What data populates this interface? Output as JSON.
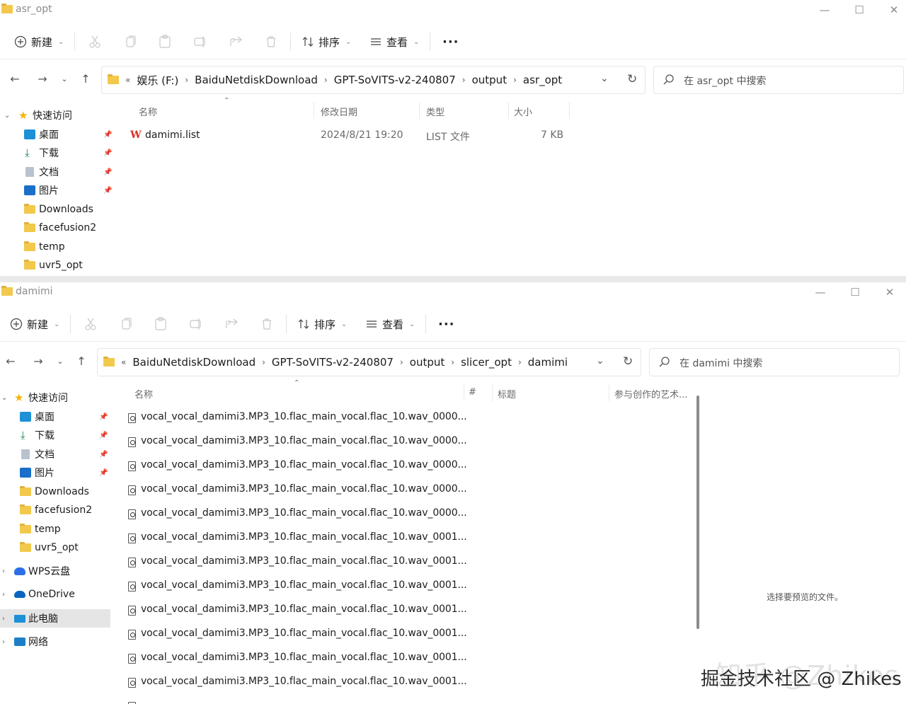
{
  "window1": {
    "title": "asr_opt",
    "toolbar": {
      "new": "新建",
      "sort": "排序",
      "view": "查看",
      "more": "···"
    },
    "breadcrumb": {
      "overflow": "«",
      "items": [
        "娱乐 (F:)",
        "BaiduNetdiskDownload",
        "GPT-SoVITS-v2-240807",
        "output",
        "asr_opt"
      ]
    },
    "search_placeholder": "在 asr_opt 中搜索",
    "sidebar": {
      "quick_access": "快速访问",
      "items": [
        "桌面",
        "下载",
        "文档",
        "图片",
        "Downloads",
        "facefusion2",
        "temp",
        "uvr5_opt"
      ]
    },
    "columns": {
      "name": "名称",
      "modified": "修改日期",
      "type": "类型",
      "size": "大小"
    },
    "files": [
      {
        "name": "damimi.list",
        "modified": "2024/8/21 19:20",
        "type": "LIST 文件",
        "size": "7 KB"
      }
    ]
  },
  "window2": {
    "title": "damimi",
    "toolbar": {
      "new": "新建",
      "sort": "排序",
      "view": "查看",
      "more": "···"
    },
    "breadcrumb": {
      "overflow": "«",
      "items": [
        "BaiduNetdiskDownload",
        "GPT-SoVITS-v2-240807",
        "output",
        "slicer_opt",
        "damimi"
      ]
    },
    "search_placeholder": "在 damimi 中搜索",
    "sidebar": {
      "quick_access": "快速访问",
      "items": [
        "桌面",
        "下载",
        "文档",
        "图片",
        "Downloads",
        "facefusion2",
        "temp",
        "uvr5_opt"
      ],
      "wps": "WPS云盘",
      "onedrive": "OneDrive",
      "this_pc": "此电脑",
      "network": "网络"
    },
    "columns": {
      "name": "名称",
      "number": "#",
      "title": "标题",
      "contributing_artists": "参与创作的艺术..."
    },
    "files": [
      "vocal_vocal_damimi3.MP3_10.flac_main_vocal.flac_10.wav_0000...",
      "vocal_vocal_damimi3.MP3_10.flac_main_vocal.flac_10.wav_0000...",
      "vocal_vocal_damimi3.MP3_10.flac_main_vocal.flac_10.wav_0000...",
      "vocal_vocal_damimi3.MP3_10.flac_main_vocal.flac_10.wav_0000...",
      "vocal_vocal_damimi3.MP3_10.flac_main_vocal.flac_10.wav_0000...",
      "vocal_vocal_damimi3.MP3_10.flac_main_vocal.flac_10.wav_0001...",
      "vocal_vocal_damimi3.MP3_10.flac_main_vocal.flac_10.wav_0001...",
      "vocal_vocal_damimi3.MP3_10.flac_main_vocal.flac_10.wav_0001...",
      "vocal_vocal_damimi3.MP3_10.flac_main_vocal.flac_10.wav_0001...",
      "vocal_vocal_damimi3.MP3_10.flac_main_vocal.flac_10.wav_0001...",
      "vocal_vocal_damimi3.MP3_10.flac_main_vocal.flac_10.wav_0001...",
      "vocal_vocal_damimi3.MP3_10.flac_main_vocal.flac_10.wav_0001..."
    ],
    "preview_text": "选择要预览的文件。"
  },
  "watermark": {
    "faint": "知乎 @Zhikes",
    "text": "掘金技术社区 @ Zhikes"
  },
  "colors": {
    "folder": "#f2c94c",
    "accent": "#0a64c2",
    "wps_red": "#d93025"
  }
}
